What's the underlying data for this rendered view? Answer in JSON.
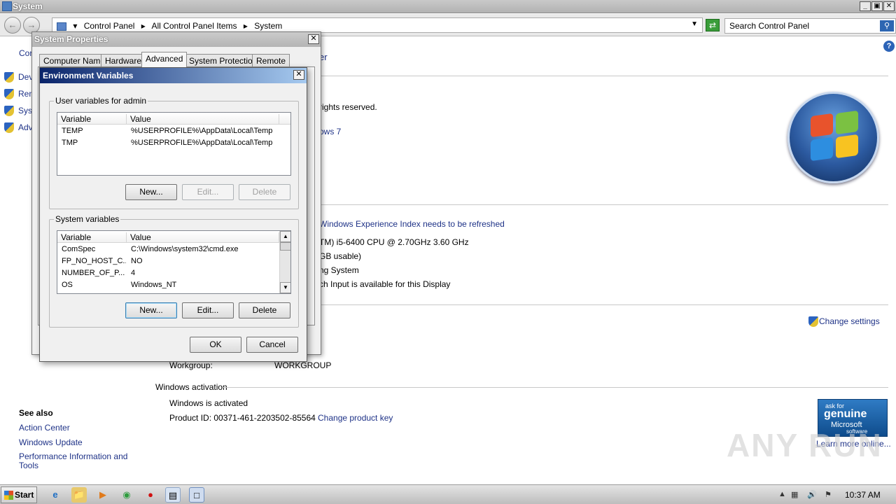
{
  "window": {
    "title": "System"
  },
  "address": {
    "crumbs": [
      "Control Panel",
      "All Control Panel Items",
      "System"
    ]
  },
  "search": {
    "placeholder": "Search Control Panel"
  },
  "left_nav": {
    "truncated_home": "Cor",
    "items": [
      "Dev",
      "Ren",
      "Sys",
      "Adv"
    ]
  },
  "main": {
    "partial_heading": "er",
    "copyright_partial": "rights reserved.",
    "edition_partial": "ows 7",
    "experience_link": "Windows Experience Index needs to be refreshed",
    "processor_partial": "TM) i5-6400 CPU @ 2.70GHz   3.60 GHz",
    "ram_partial": "GB usable)",
    "system_type_partial": "ng System",
    "pen_touch_partial": "ch Input is available for this Display",
    "change_settings": "Change settings",
    "workgroup_label": "Workgroup:",
    "workgroup_value": "WORKGROUP",
    "activation_heading": "Windows activation",
    "activation_status": "Windows is activated",
    "product_id": "Product ID:  00371-461-2203502-85564",
    "change_product_key": "Change product key",
    "learn_more": "Learn more online..."
  },
  "genuine": {
    "line1": "ask for",
    "line2": "genuine",
    "line3": "Microsoft",
    "line4": "software"
  },
  "see_also": {
    "heading": "See also",
    "links": [
      "Action Center",
      "Windows Update",
      "Performance Information and Tools"
    ]
  },
  "sysprop": {
    "title": "System Properties",
    "tabs": [
      "Computer Name",
      "Hardware",
      "Advanced",
      "System Protection",
      "Remote"
    ],
    "active_tab": "Advanced"
  },
  "envvars": {
    "title": "Environment Variables",
    "user_group": "User variables for admin",
    "columns": [
      "Variable",
      "Value"
    ],
    "user_rows": [
      {
        "var": "TEMP",
        "value": "%USERPROFILE%\\AppData\\Local\\Temp"
      },
      {
        "var": "TMP",
        "value": "%USERPROFILE%\\AppData\\Local\\Temp"
      }
    ],
    "user_buttons": {
      "new": "New...",
      "edit": "Edit...",
      "delete": "Delete"
    },
    "system_group": "System variables",
    "system_rows": [
      {
        "var": "ComSpec",
        "value": "C:\\Windows\\system32\\cmd.exe"
      },
      {
        "var": "FP_NO_HOST_C...",
        "value": "NO"
      },
      {
        "var": "NUMBER_OF_P...",
        "value": "4"
      },
      {
        "var": "OS",
        "value": "Windows_NT"
      }
    ],
    "system_buttons": {
      "new": "New...",
      "edit": "Edit...",
      "delete": "Delete"
    },
    "ok": "OK",
    "cancel": "Cancel"
  },
  "taskbar": {
    "start": "Start",
    "clock": "10:37 AM"
  },
  "watermark": "ANY RUN"
}
